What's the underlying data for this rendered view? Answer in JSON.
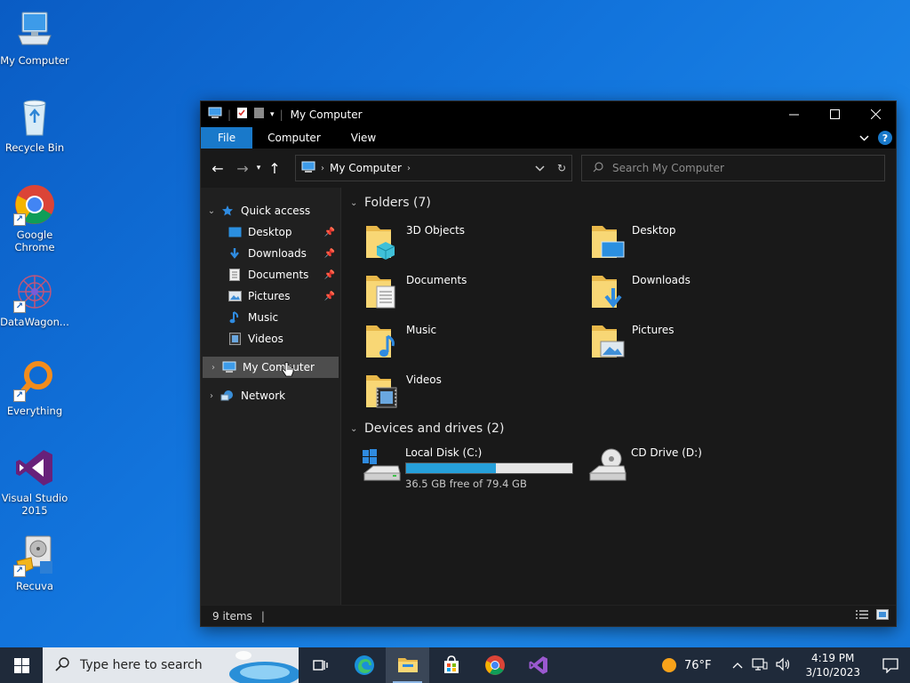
{
  "desktop": {
    "icons": [
      {
        "label": "My Computer",
        "icon": "computer-icon"
      },
      {
        "label": "Recycle Bin",
        "icon": "recycle-bin-icon"
      },
      {
        "label": "Google Chrome",
        "icon": "chrome-icon"
      },
      {
        "label": "DataWagon...",
        "icon": "datawagon-icon"
      },
      {
        "label": "Everything",
        "icon": "everything-search-icon"
      },
      {
        "label": "Visual Studio 2015",
        "icon": "visual-studio-icon"
      },
      {
        "label": "Recuva",
        "icon": "recuva-icon"
      }
    ]
  },
  "window": {
    "title": "My Computer",
    "ribbon": {
      "tabs": [
        "File",
        "Computer",
        "View"
      ],
      "help": "?"
    },
    "address": {
      "crumb": "My Computer"
    },
    "search": {
      "placeholder": "Search My Computer"
    },
    "nav": {
      "quick_access": "Quick access",
      "quick_items": [
        {
          "label": "Desktop",
          "pinned": true
        },
        {
          "label": "Downloads",
          "pinned": true
        },
        {
          "label": "Documents",
          "pinned": true
        },
        {
          "label": "Pictures",
          "pinned": true
        },
        {
          "label": "Music",
          "pinned": false
        },
        {
          "label": "Videos",
          "pinned": false
        }
      ],
      "my_computer": "My Computer",
      "network": "Network"
    },
    "folders": {
      "header": "Folders (7)",
      "items": [
        "3D Objects",
        "Desktop",
        "Documents",
        "Downloads",
        "Music",
        "Pictures",
        "Videos"
      ]
    },
    "drives": {
      "header": "Devices and drives (2)",
      "items": [
        {
          "name": "Local Disk (C:)",
          "free": "36.5 GB free of 79.4 GB",
          "used_fraction": 0.54
        },
        {
          "name": "CD Drive (D:)"
        }
      ]
    },
    "status": {
      "items": "9 items"
    }
  },
  "taskbar": {
    "search_placeholder": "Type here to search",
    "weather": "76°F",
    "time": "4:19 PM",
    "date": "3/10/2023"
  },
  "colors": {
    "accent": "#1979ca",
    "drive_bar": "#26a0da"
  }
}
